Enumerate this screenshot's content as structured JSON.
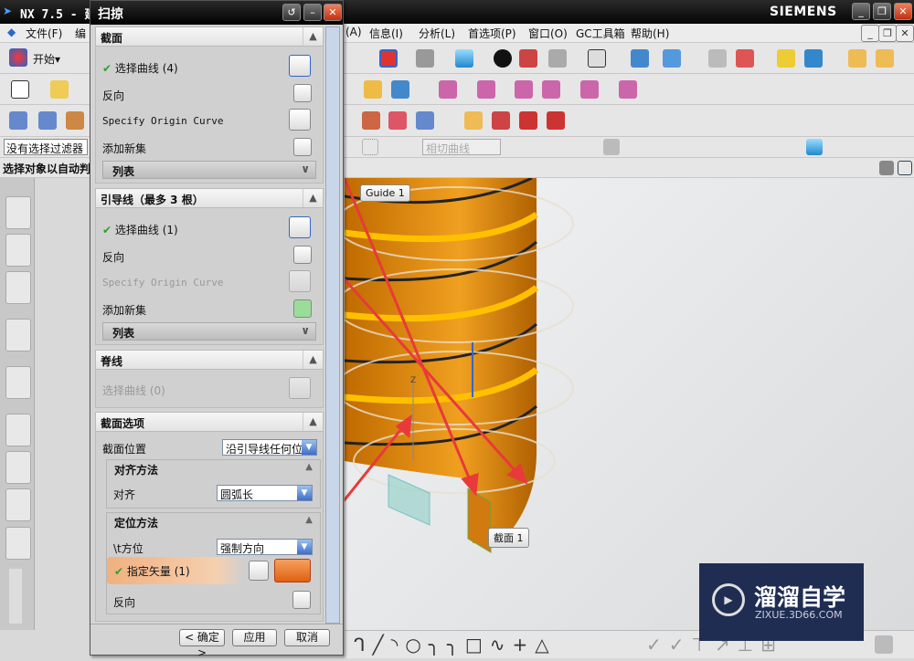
{
  "app": {
    "title": "NX 7.5 - 建",
    "brand": "SIEMENS"
  },
  "menu": {
    "left_items": [
      "文件(F)",
      "编"
    ],
    "right_items": [
      "(A)",
      "信息(I)",
      "分析(L)",
      "首选项(P)",
      "窗口(O)",
      "GC工具箱",
      "帮助(H)"
    ]
  },
  "toolbar": {
    "start_label": "开始▾",
    "filter_value": "没有选择过滤器",
    "curve_rule": "相切曲线",
    "status": "选择对象以自动判"
  },
  "dialog": {
    "title": "扫掠",
    "section": {
      "header": "截面",
      "select_curve": "选择曲线 (4)",
      "reverse": "反向",
      "origin_curve": "Specify Origin Curve",
      "add_set": "添加新集",
      "list": "列表"
    },
    "guides": {
      "header": "引导线（最多 3 根）",
      "select_curve": "选择曲线 (1)",
      "reverse": "反向",
      "origin_curve": "Specify Origin Curve",
      "add_set": "添加新集",
      "list": "列表"
    },
    "spine": {
      "header": "脊线",
      "select_curve": "选择曲线 (0)"
    },
    "options": {
      "header": "截面选项",
      "position_label": "截面位置",
      "position_value": "沿引导线任何位",
      "align": {
        "header": "对齐方法",
        "label": "对齐",
        "value": "圆弧长"
      },
      "orient": {
        "header": "定位方法",
        "label": "\\t方位",
        "value": "强制方向",
        "vector": "指定矢量 (1)",
        "reverse": "反向"
      }
    },
    "buttons": {
      "ok": "< 确定 >",
      "apply": "应用",
      "cancel": "取消"
    }
  },
  "viewport": {
    "guide_tag": "Guide 1",
    "section_tag": "截面 1",
    "axis_label": "Z"
  },
  "watermark": {
    "name": "溜溜自学",
    "url": "ZIXUE.3D66.COM"
  },
  "colors": {
    "accent": "#e88a2a",
    "highlight": "#f0b080",
    "annotation": "#e83a3a"
  }
}
